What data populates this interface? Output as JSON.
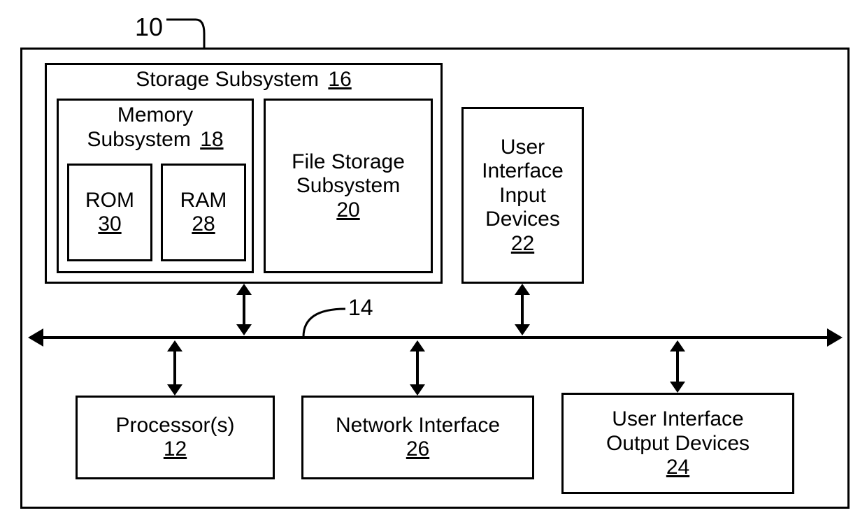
{
  "system": {
    "ref": "10"
  },
  "bus": {
    "ref": "14"
  },
  "storage_subsystem": {
    "label": "Storage Subsystem",
    "ref": "16"
  },
  "memory_subsystem": {
    "label": "Memory Subsystem",
    "ref": "18"
  },
  "rom": {
    "label": "ROM",
    "ref": "30"
  },
  "ram": {
    "label": "RAM",
    "ref": "28"
  },
  "file_storage": {
    "label1": "File Storage",
    "label2": "Subsystem",
    "ref": "20"
  },
  "ui_input": {
    "label1": "User",
    "label2": "Interface",
    "label3": "Input",
    "label4": "Devices",
    "ref": "22"
  },
  "ui_output": {
    "label1": "User Interface",
    "label2": "Output Devices",
    "ref": "24"
  },
  "processor": {
    "label": "Processor(s)",
    "ref": "12"
  },
  "network": {
    "label": "Network Interface",
    "ref": "26"
  }
}
